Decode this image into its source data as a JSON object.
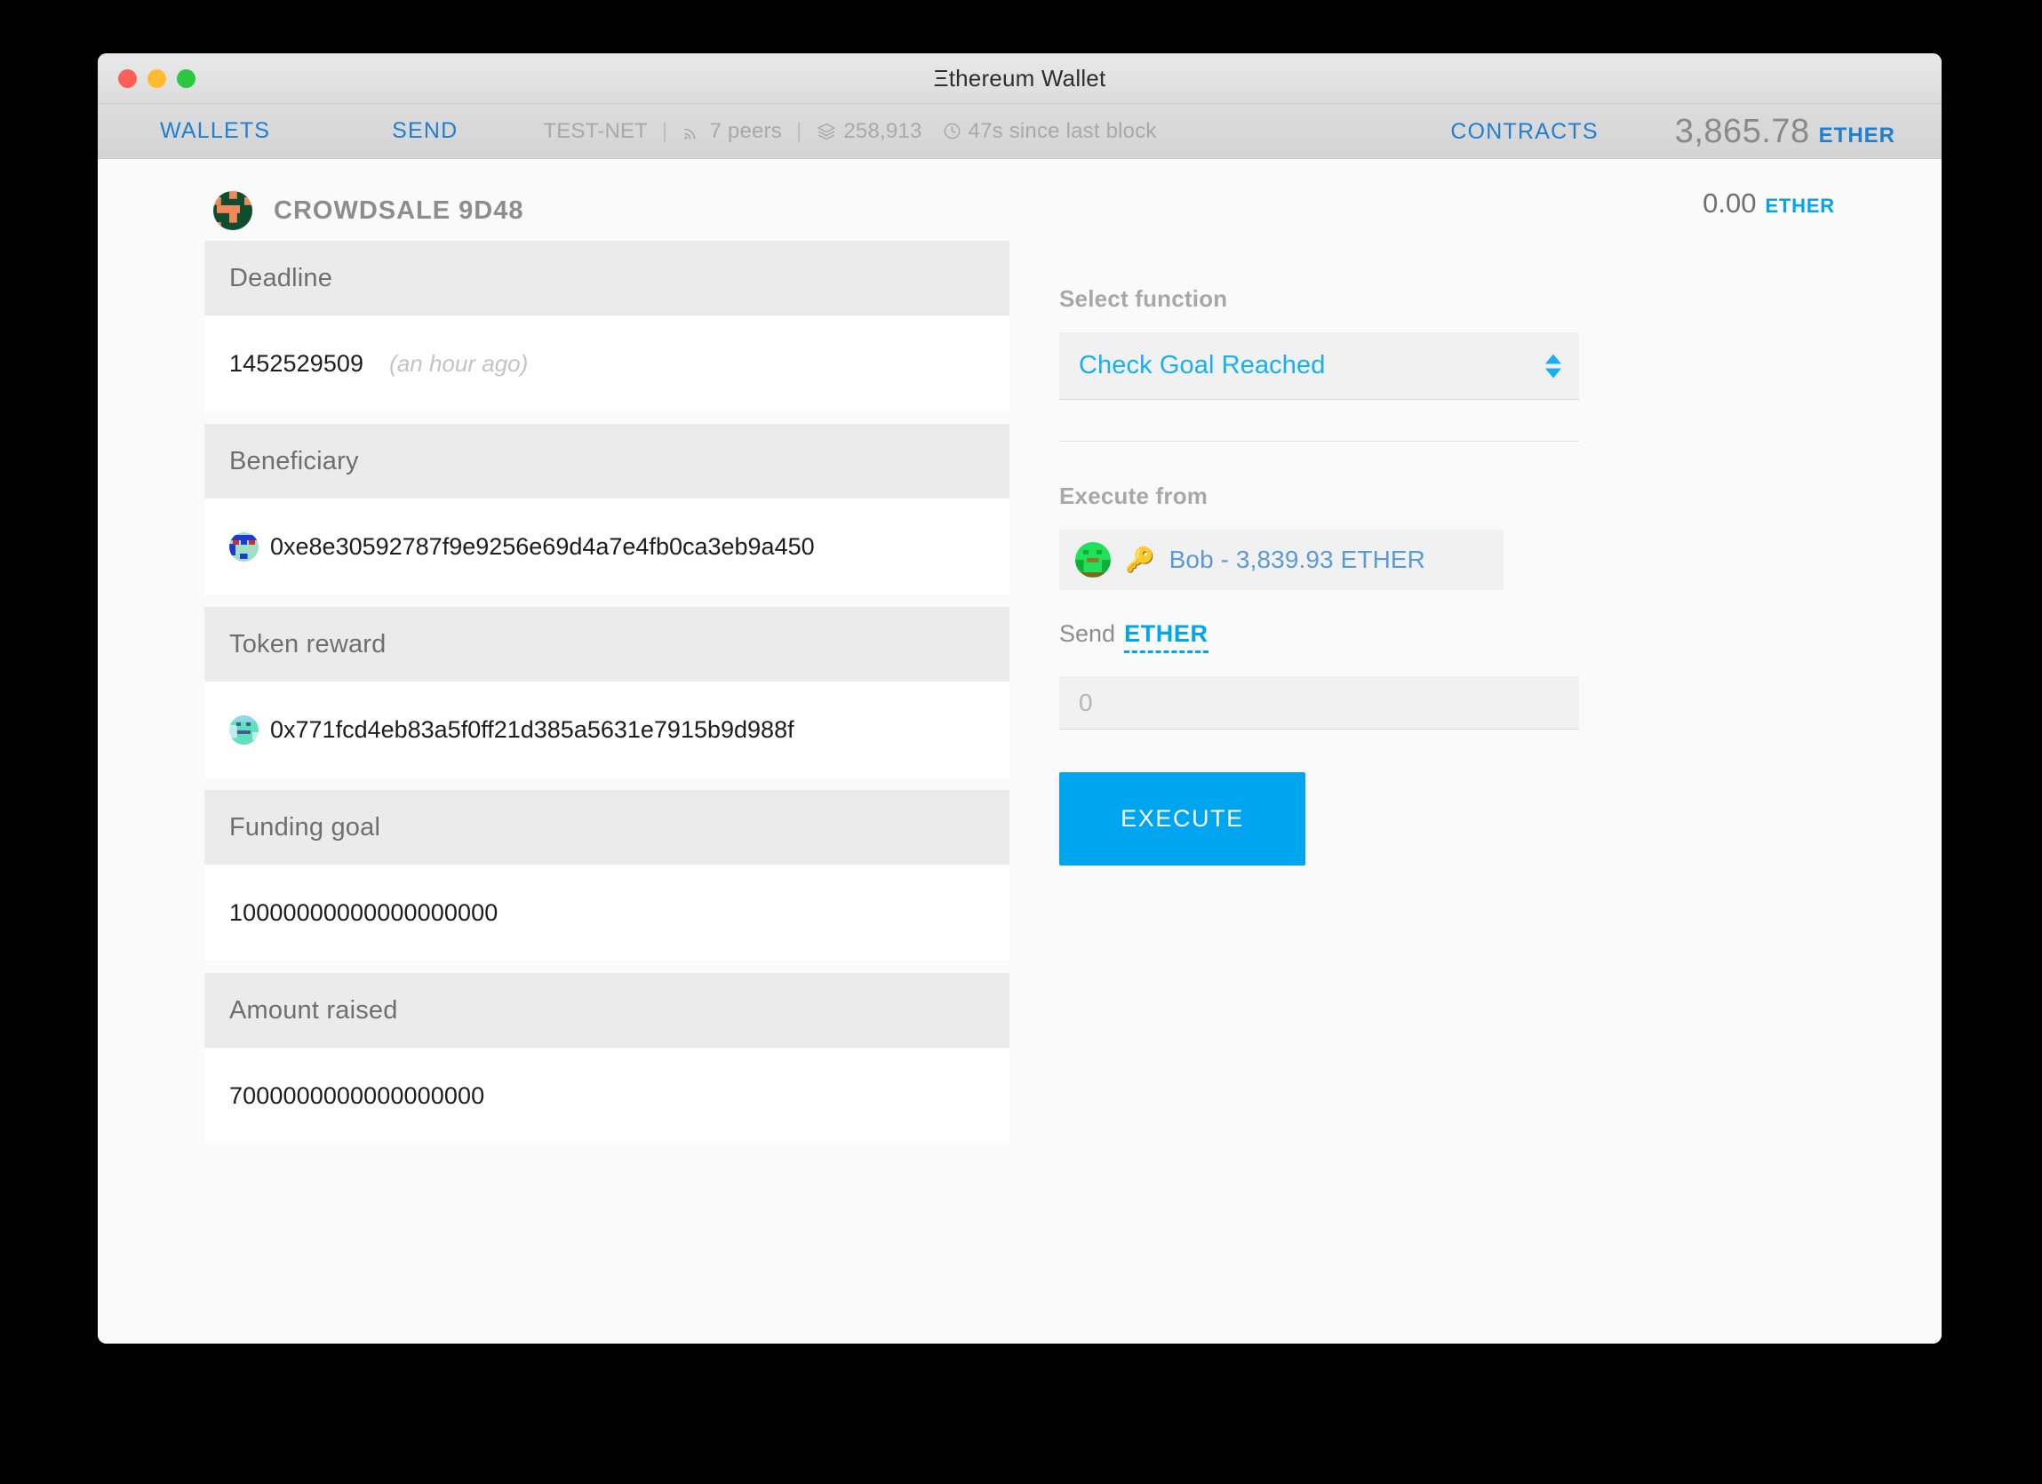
{
  "window": {
    "title": "Ξthereum Wallet",
    "traffic_lights": [
      "close",
      "minimize",
      "maximize"
    ]
  },
  "nav": {
    "wallets_label": "WALLETS",
    "send_label": "SEND",
    "contracts_label": "CONTRACTS",
    "network": "TEST-NET",
    "peers": "7 peers",
    "block_number": "258,913",
    "last_block": "47s since last block",
    "separator": "|",
    "balance_amount": "3,865.78",
    "balance_unit": "ETHER"
  },
  "contract": {
    "name": "CROWDSALE 9D48",
    "balance_amount": "0.00",
    "balance_unit": "ETHER",
    "fields": [
      {
        "label": "Deadline",
        "value": "1452529509",
        "note": "(an hour ago)",
        "has_identicon": false
      },
      {
        "label": "Beneficiary",
        "value": "0xe8e30592787f9e9256e69d4a7e4fb0ca3eb9a450",
        "note": "",
        "has_identicon": true
      },
      {
        "label": "Token reward",
        "value": "0x771fcd4eb83a5f0ff21d385a5631e7915b9d988f",
        "note": "",
        "has_identicon": true
      },
      {
        "label": "Funding goal",
        "value": "10000000000000000000",
        "note": "",
        "has_identicon": false
      },
      {
        "label": "Amount raised",
        "value": "7000000000000000000",
        "note": "",
        "has_identicon": false
      }
    ]
  },
  "panel": {
    "select_function_label": "Select function",
    "selected_function": "Check Goal Reached",
    "execute_from_label": "Execute from",
    "account_label": "Bob - 3,839.93 ETHER",
    "key_glyph": "🔑",
    "send_label": "Send",
    "send_unit": "ETHER",
    "amount_placeholder": "0",
    "amount_value": "",
    "execute_label": "EXECUTE"
  },
  "colors": {
    "accent_blue": "#00a5ef",
    "link_blue": "#1f7fd0",
    "select_blue": "#15b0f5",
    "muted_gray": "#a8a8a8",
    "header_gray": "#ebebeb"
  }
}
